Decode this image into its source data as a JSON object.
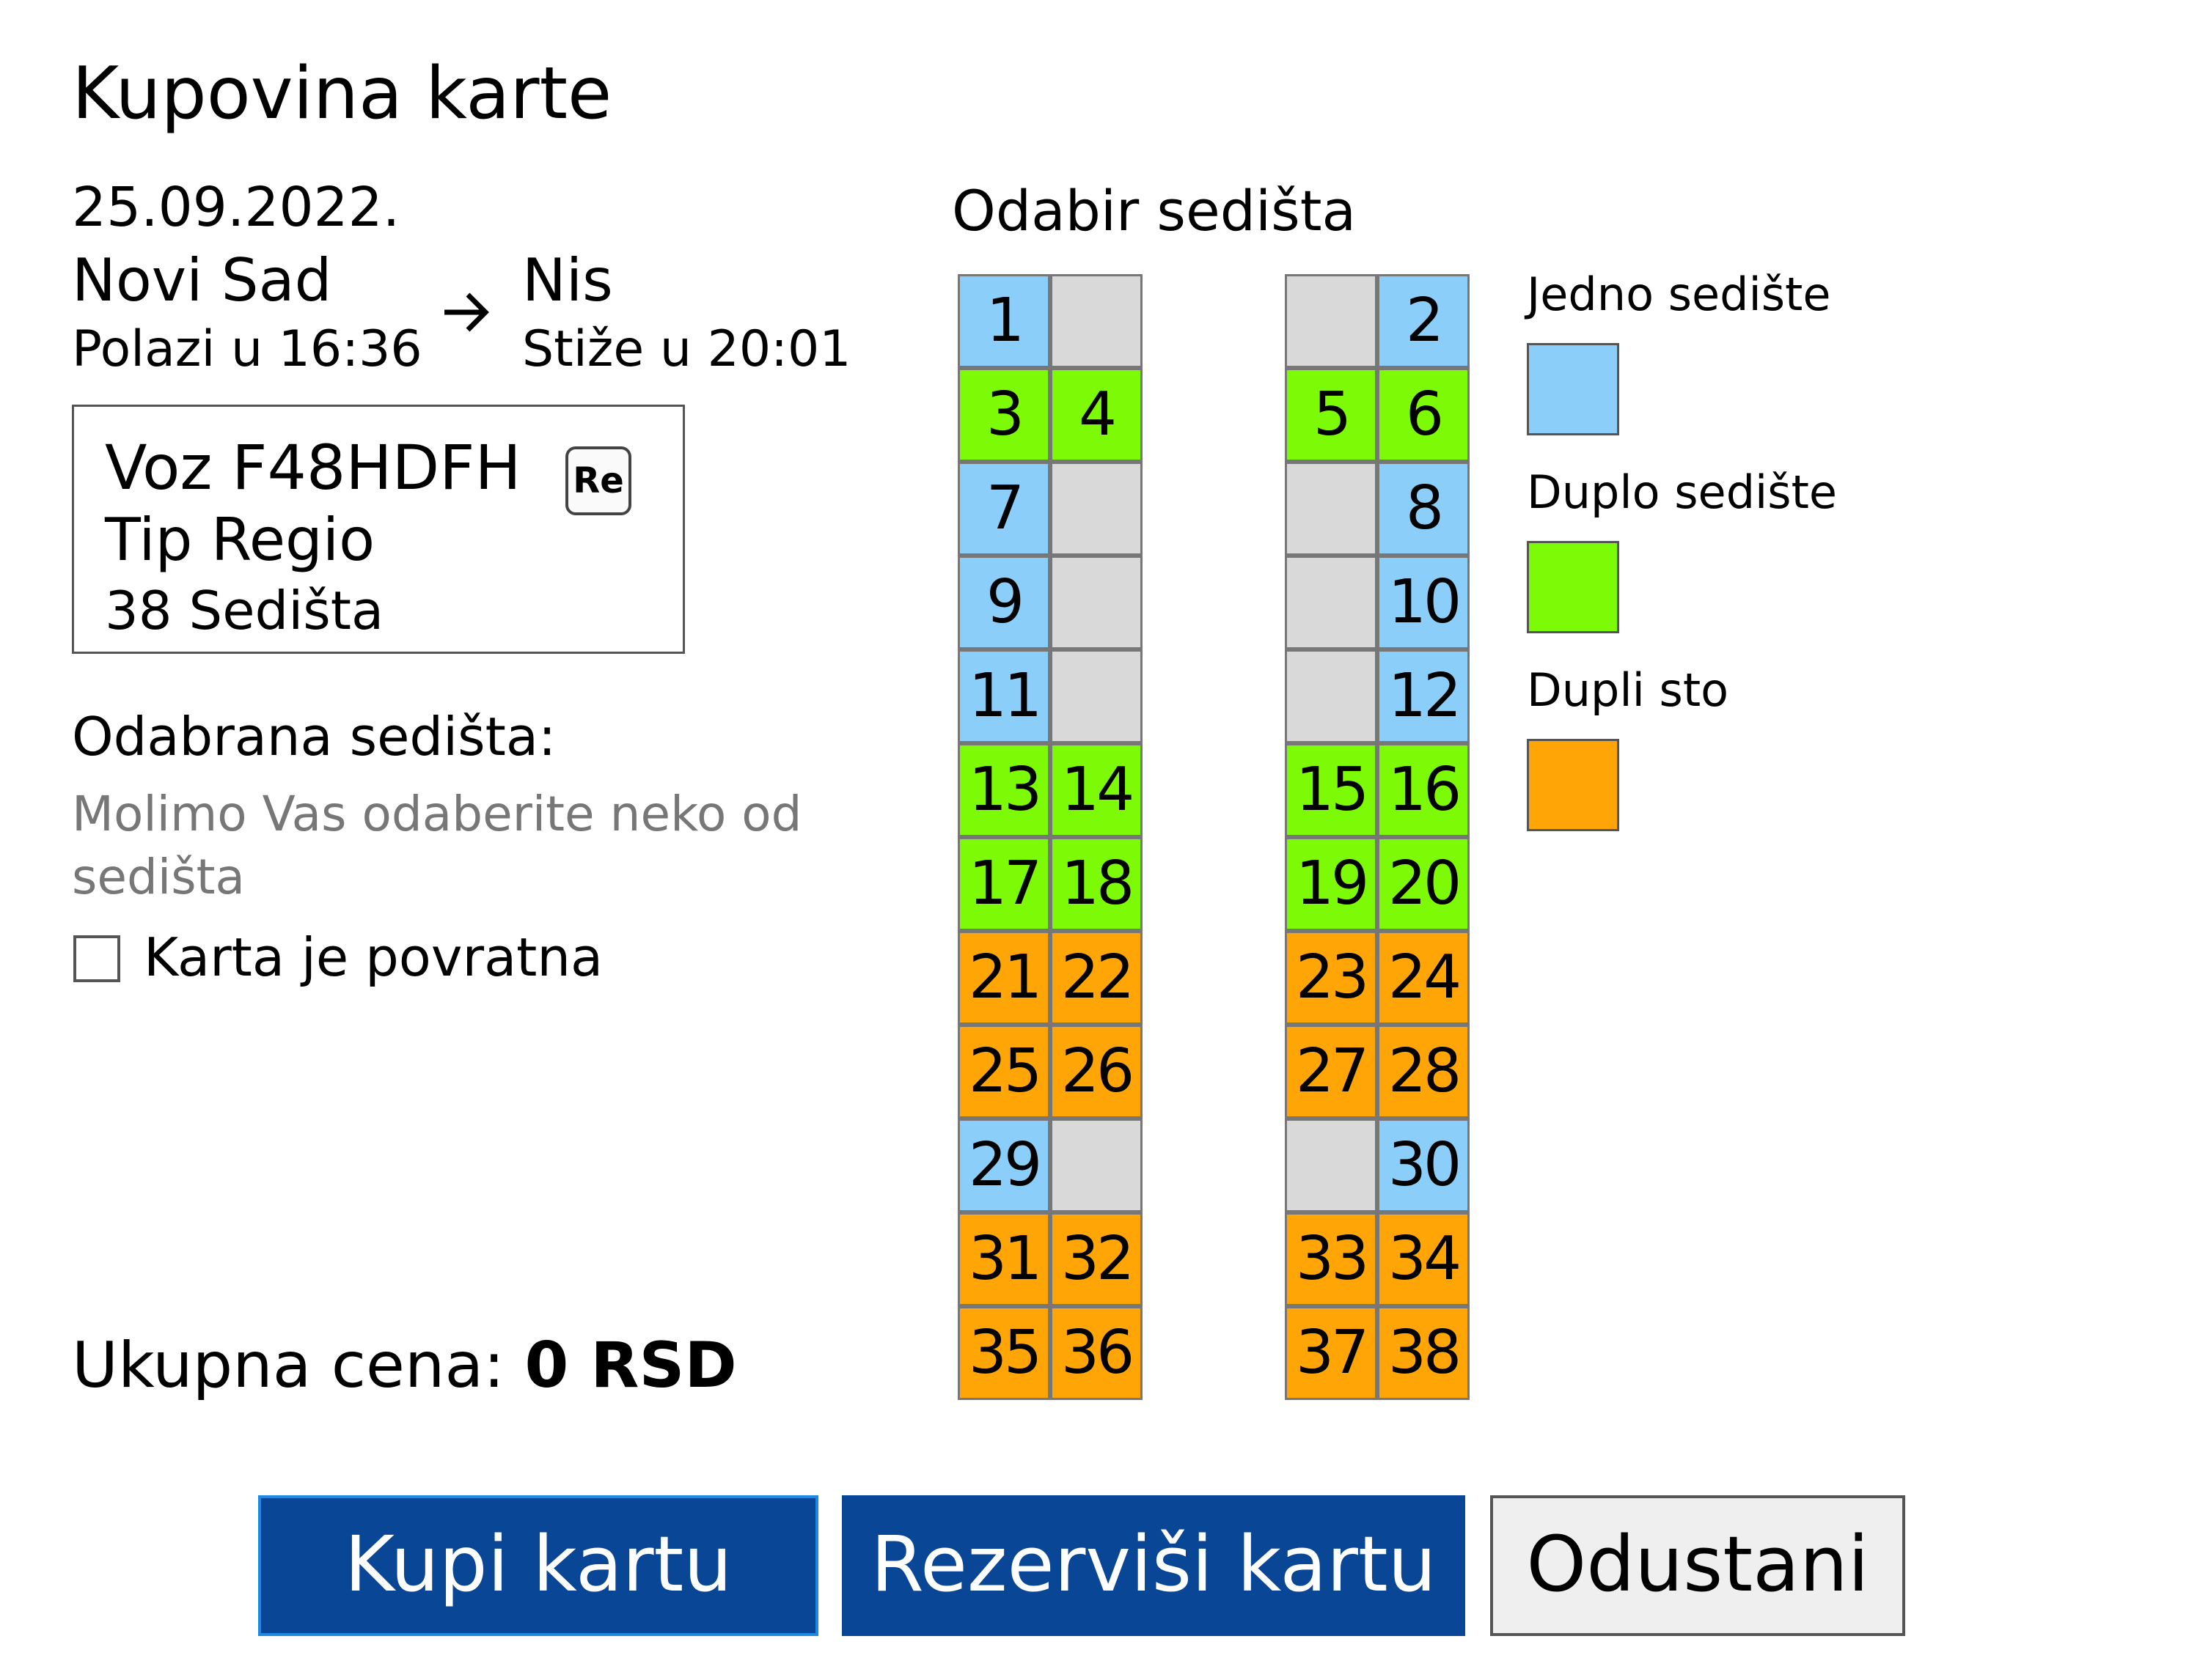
{
  "page": {
    "title": "Kupovina karte"
  },
  "trip": {
    "date": "25.09.2022.",
    "from": "Novi Sad",
    "to": "Nis",
    "departure": "Polazi u 16:36",
    "arrival": "Stiže u 20:01"
  },
  "train": {
    "name": "Voz F48HDFH",
    "badge": "Re",
    "type": "Tip Regio",
    "seats": "38 Sedišta"
  },
  "selection": {
    "title": "Odabrana sedišta:",
    "placeholder": "Molimo Vas odaberite neko od sedišta",
    "return_label": "Karta je povratna",
    "return_checked": false
  },
  "total": {
    "label": "Ukupna cena:",
    "value": "0 RSD"
  },
  "seat_map": {
    "title": "Odabir sedišta",
    "rows": [
      [
        [
          "1",
          "single"
        ],
        [
          "",
          "empty"
        ],
        [
          "",
          "empty"
        ],
        [
          "2",
          "single"
        ]
      ],
      [
        [
          "3",
          "double"
        ],
        [
          "4",
          "double"
        ],
        [
          "5",
          "double"
        ],
        [
          "6",
          "double"
        ]
      ],
      [
        [
          "7",
          "single"
        ],
        [
          "",
          "empty"
        ],
        [
          "",
          "empty"
        ],
        [
          "8",
          "single"
        ]
      ],
      [
        [
          "9",
          "single"
        ],
        [
          "",
          "empty"
        ],
        [
          "",
          "empty"
        ],
        [
          "10",
          "single"
        ]
      ],
      [
        [
          "11",
          "single"
        ],
        [
          "",
          "empty"
        ],
        [
          "",
          "empty"
        ],
        [
          "12",
          "single"
        ]
      ],
      [
        [
          "13",
          "double"
        ],
        [
          "14",
          "double"
        ],
        [
          "15",
          "double"
        ],
        [
          "16",
          "double"
        ]
      ],
      [
        [
          "17",
          "double"
        ],
        [
          "18",
          "double"
        ],
        [
          "19",
          "double"
        ],
        [
          "20",
          "double"
        ]
      ],
      [
        [
          "21",
          "table"
        ],
        [
          "22",
          "table"
        ],
        [
          "23",
          "table"
        ],
        [
          "24",
          "table"
        ]
      ],
      [
        [
          "25",
          "table"
        ],
        [
          "26",
          "table"
        ],
        [
          "27",
          "table"
        ],
        [
          "28",
          "table"
        ]
      ],
      [
        [
          "29",
          "single"
        ],
        [
          "",
          "empty"
        ],
        [
          "",
          "empty"
        ],
        [
          "30",
          "single"
        ]
      ],
      [
        [
          "31",
          "table"
        ],
        [
          "32",
          "table"
        ],
        [
          "33",
          "table"
        ],
        [
          "34",
          "table"
        ]
      ],
      [
        [
          "35",
          "table"
        ],
        [
          "36",
          "table"
        ],
        [
          "37",
          "table"
        ],
        [
          "38",
          "table"
        ]
      ]
    ]
  },
  "legend": [
    {
      "key": "single",
      "label": "Jedno sedište",
      "color": "#8ccefa"
    },
    {
      "key": "double",
      "label": "Duplo sedište",
      "color": "#7dfa05"
    },
    {
      "key": "table",
      "label": "Dupli sto",
      "color": "#ffa505"
    }
  ],
  "buttons": {
    "buy": "Kupi kartu",
    "reserve": "Rezerviši kartu",
    "cancel": "Odustani"
  }
}
